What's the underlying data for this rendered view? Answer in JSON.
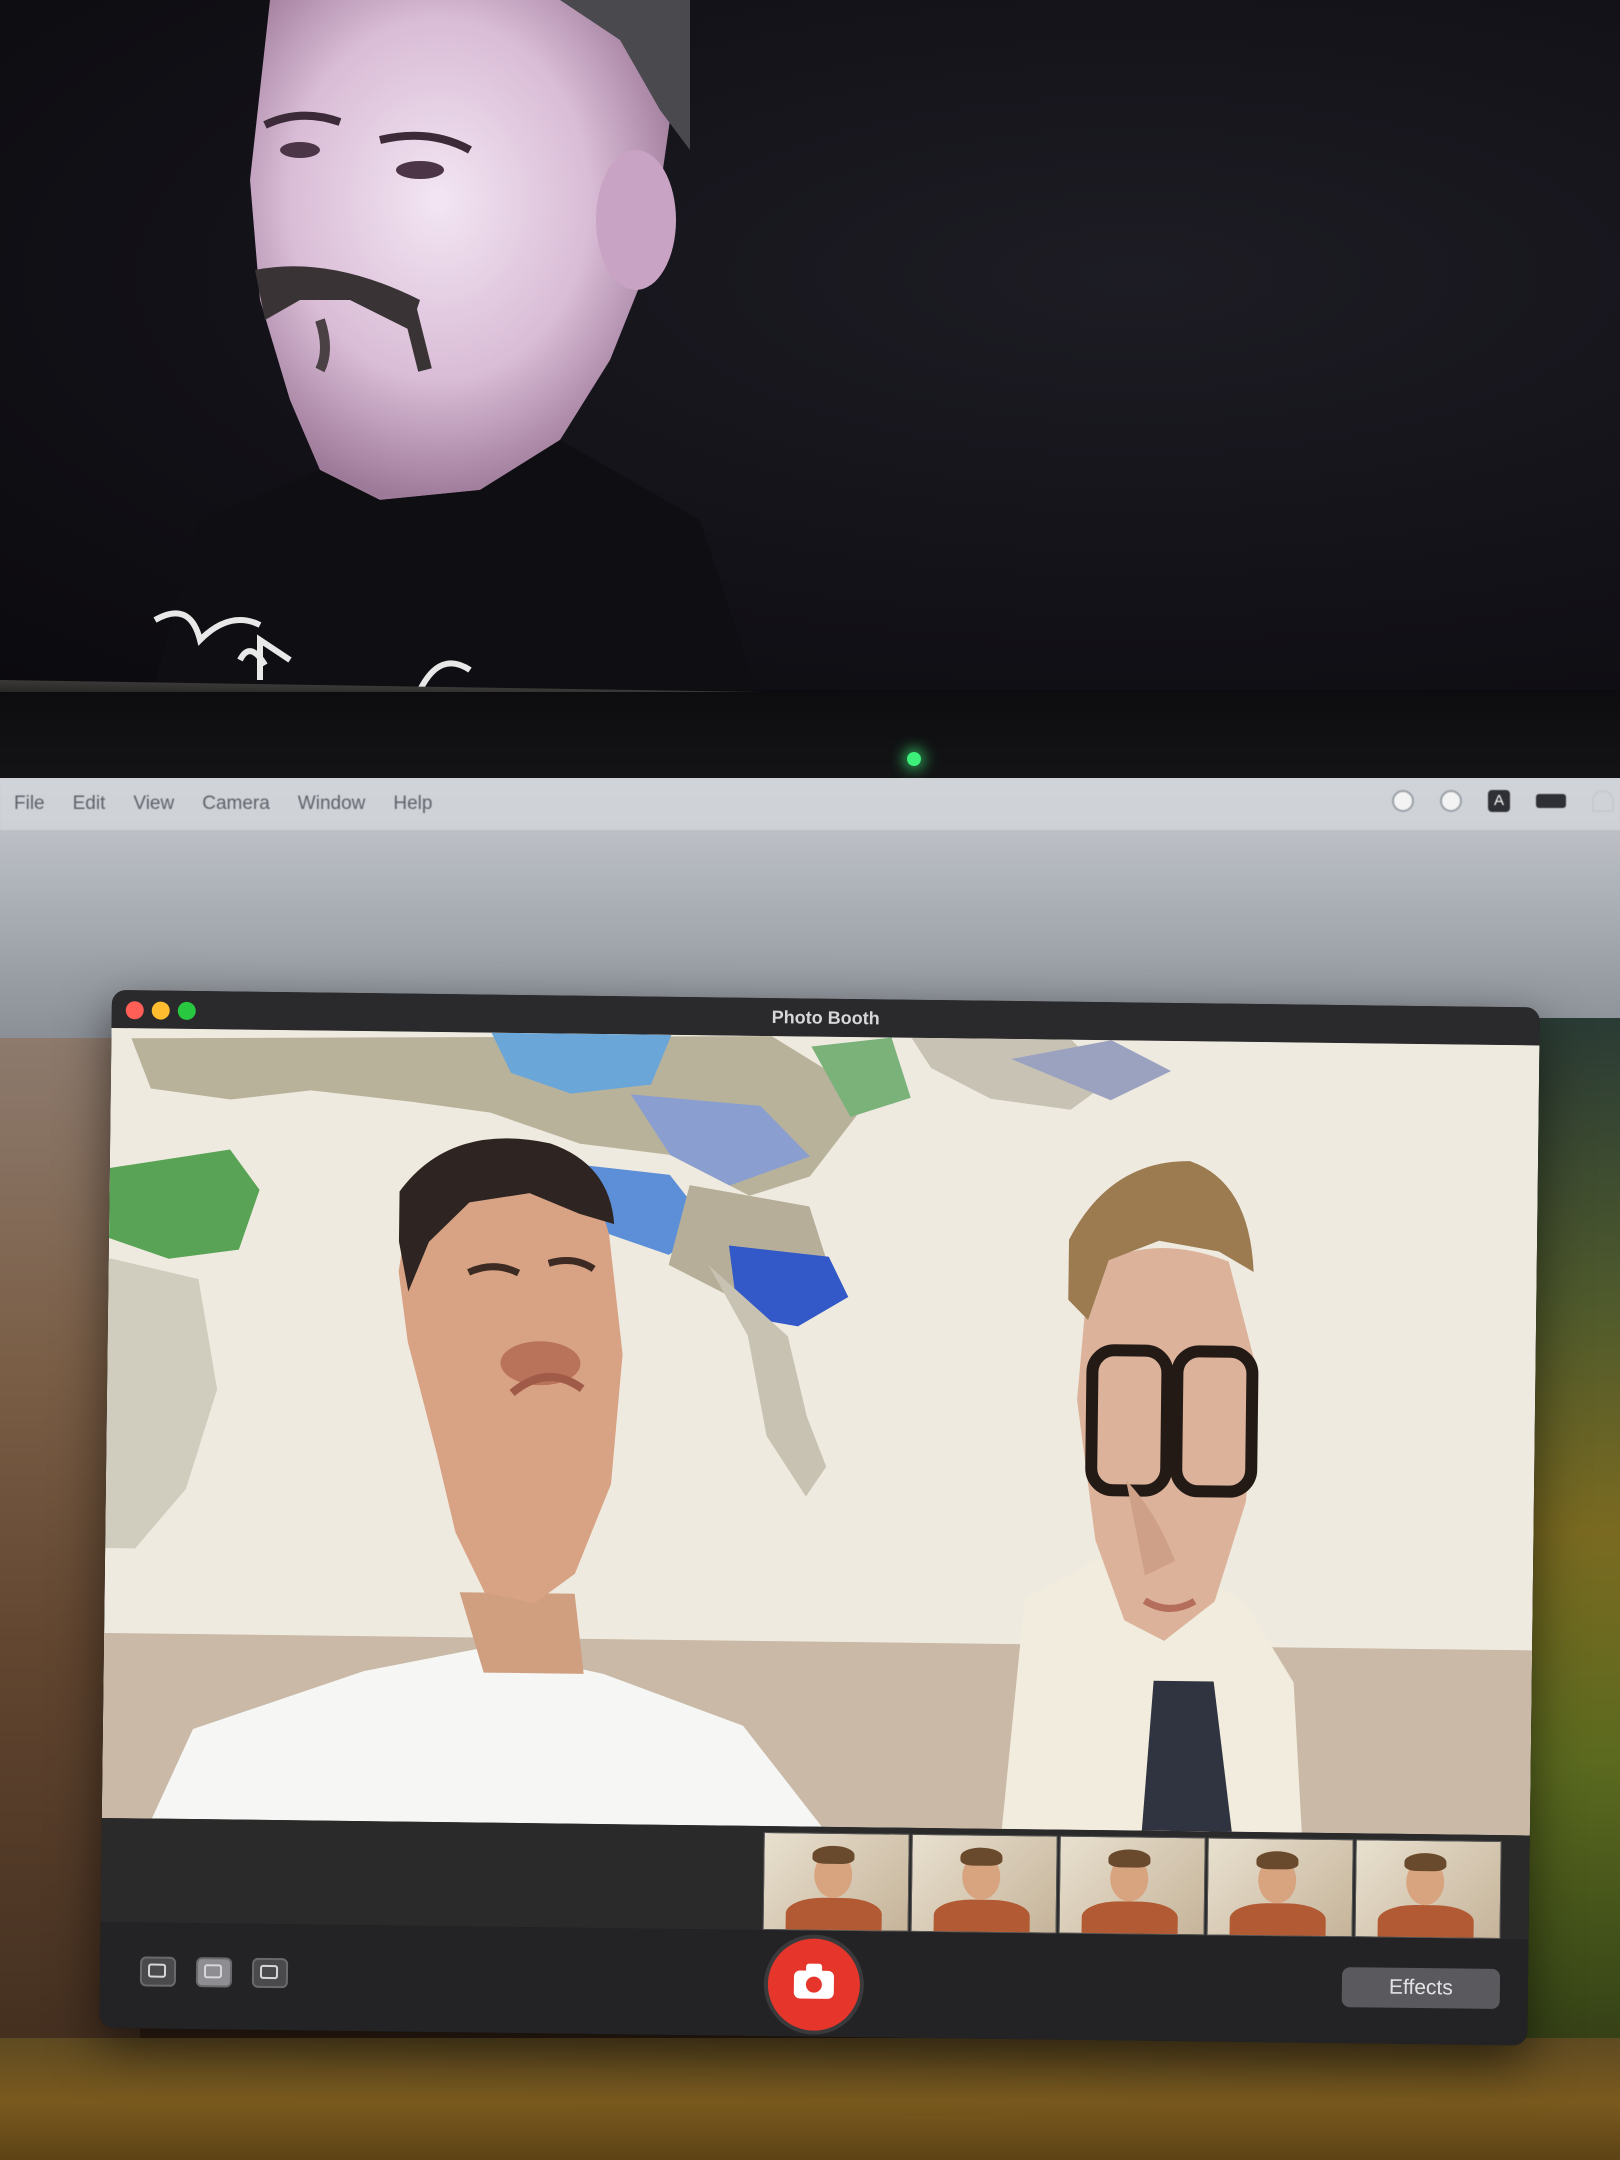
{
  "menubar": {
    "items": [
      "File",
      "Edit",
      "View",
      "Camera",
      "Window",
      "Help"
    ],
    "status_icons": [
      "control-center-icon",
      "siri-icon",
      "input-source-icon",
      "battery-icon",
      "wifi-icon"
    ],
    "input_source_label": "A"
  },
  "window": {
    "title": "Photo Booth",
    "mode_buttons": [
      "four-up-mode-icon",
      "single-photo-mode-icon",
      "video-mode-icon"
    ],
    "effects_label": "Effects",
    "thumbnails_count": 5
  },
  "colors": {
    "shutter": "#e6362c",
    "close": "#ff5f57",
    "minimize": "#febc2e",
    "zoom": "#28c840",
    "camera_led": "#3cf07a"
  }
}
